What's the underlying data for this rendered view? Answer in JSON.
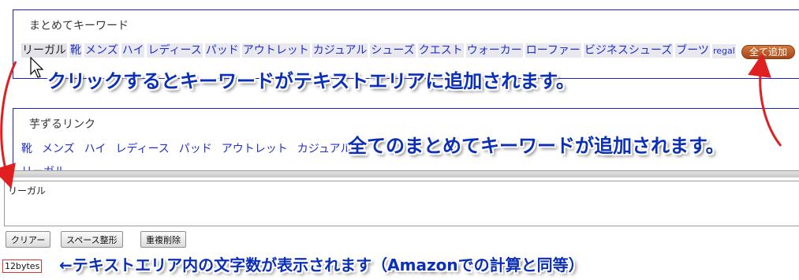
{
  "section1": {
    "title": "まとめてキーワード",
    "keywords": [
      "リーガル",
      "靴",
      "メンズ",
      "ハイ",
      "レディース",
      "パッド",
      "アウトレット",
      "カジュアル",
      "シューズ",
      "クエスト",
      "ウォーカー",
      "ローファー",
      "ビジネスシューズ",
      "ブーツ",
      "regal"
    ],
    "add_all_label": "全て追加"
  },
  "section2": {
    "title": "芋ずるリンク",
    "keywords": [
      "靴",
      "メンズ",
      "ハイ",
      "レディース",
      "パッド",
      "アウトレット",
      "カジュアル"
    ],
    "wrap_text": "リーガル"
  },
  "textarea": {
    "value": "リーガル"
  },
  "buttons": {
    "clear": "クリアー",
    "space_format": "スペース整形",
    "dedup": "重複削除"
  },
  "bytes_label": "12bytes",
  "annotations": {
    "click_note": "クリックするとキーワードがテキストエリアに追加されます。",
    "all_note": "全てのまとめてキーワードが追加されます。",
    "count_note": "←テキストエリア内の文字数が表示されます（Amazonでの計算と同等）"
  },
  "colors": {
    "link": "#1f2fd0",
    "border": "#1a22c8",
    "annotation": "#0c2fb8",
    "arrow": "#e02020",
    "add_button": "#b85a28"
  }
}
